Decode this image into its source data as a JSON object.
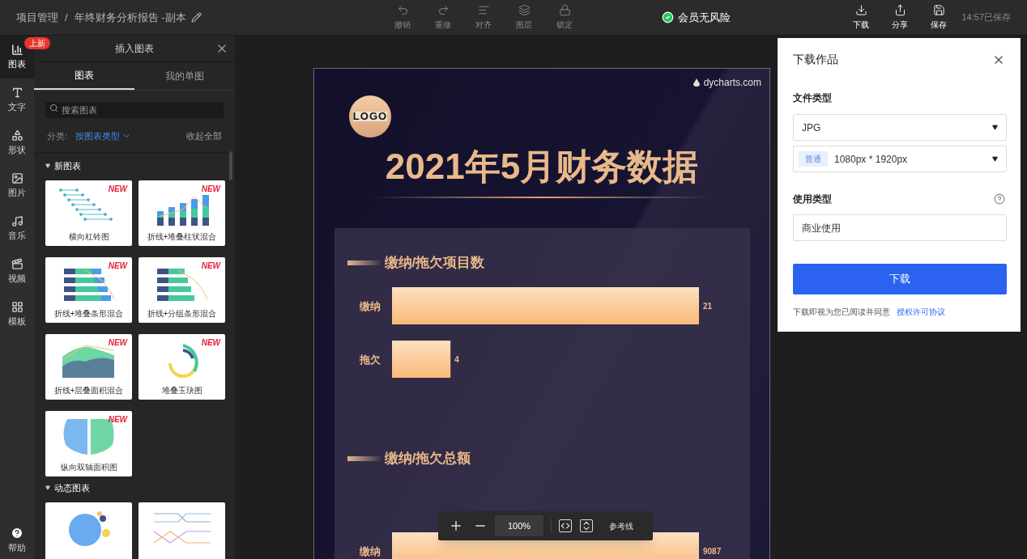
{
  "header": {
    "breadcrumb": [
      {
        "label": "项目管理"
      },
      {
        "label": "年终财务分析报告 -副本"
      }
    ],
    "separator": "/",
    "tools": [
      {
        "kind": "undo",
        "label": "撤销",
        "disabled": true
      },
      {
        "kind": "redo",
        "label": "重做",
        "disabled": true
      },
      {
        "kind": "align",
        "label": "对齐",
        "disabled": true
      },
      {
        "kind": "layers",
        "label": "图层",
        "disabled": true
      },
      {
        "kind": "lock",
        "label": "锁定",
        "disabled": true
      }
    ],
    "status": "会员无风险",
    "actions": [
      {
        "kind": "download",
        "label": "下载"
      },
      {
        "kind": "share",
        "label": "分享"
      },
      {
        "kind": "save",
        "label": "保存"
      }
    ],
    "saved": "14:57已保存"
  },
  "rail": {
    "badge": "上新",
    "items": [
      {
        "kind": "chart",
        "label": "图表",
        "selected": true
      },
      {
        "kind": "text",
        "label": "文字",
        "selected": false
      },
      {
        "kind": "shape",
        "label": "形状",
        "selected": false
      },
      {
        "kind": "image",
        "label": "图片",
        "selected": false
      },
      {
        "kind": "music",
        "label": "音乐",
        "selected": false
      },
      {
        "kind": "video",
        "label": "视频",
        "selected": false
      },
      {
        "kind": "template",
        "label": "模板",
        "selected": false
      }
    ],
    "help": "帮助"
  },
  "panel": {
    "title": "插入图表",
    "tabs": [
      {
        "label": "图表",
        "selected": true
      },
      {
        "label": "我的单图",
        "selected": false
      }
    ],
    "search": {
      "placeholder": "搜索图表"
    },
    "filter_label": "分类:",
    "filter_value": "按图表类型",
    "collapse": "收起全部",
    "sections": [
      {
        "title": "新图表",
        "expanded": true,
        "cards": [
          {
            "kind": "dumbbell",
            "label": "横向杠铃图",
            "badge": "NEW"
          },
          {
            "kind": "stacked-column-line",
            "label": "折线+堆叠柱状混合",
            "badge": "NEW"
          },
          {
            "kind": "stacked-bar-line",
            "label": "折线+堆叠条形混合",
            "badge": "NEW"
          },
          {
            "kind": "grouped-bar-line",
            "label": "折线+分组条形混合",
            "badge": "NEW"
          },
          {
            "kind": "stacked-area-line",
            "label": "折线+层叠面积混合",
            "badge": "NEW"
          },
          {
            "kind": "radial",
            "label": "堆叠玉玦图",
            "badge": "NEW"
          },
          {
            "kind": "mirror-area",
            "label": "纵向双轴面积图",
            "badge": "NEW"
          }
        ]
      },
      {
        "title": "动态图表",
        "expanded": true,
        "cards": [
          {
            "kind": "bubble"
          },
          {
            "kind": "bump"
          }
        ]
      }
    ]
  },
  "poster": {
    "brand": "dycharts.com",
    "logo": "LOGO",
    "title": "2021年5月财务数据",
    "charts": [
      {
        "heading": "缴纳/拖欠项目数",
        "chart_data": {
          "type": "bar",
          "orientation": "horizontal",
          "categories": [
            "缴纳",
            "拖欠"
          ],
          "values": [
            21,
            4
          ],
          "data_labels": true
        }
      },
      {
        "heading": "缴纳/拖欠总额",
        "chart_data": {
          "type": "bar",
          "orientation": "horizontal",
          "categories": [
            "缴纳"
          ],
          "values": [
            9087
          ],
          "data_labels": true
        }
      }
    ]
  },
  "zoom_bar": {
    "zoom": "100%",
    "guides": "参考线"
  },
  "download": {
    "title": "下载作品",
    "file_type_label": "文件类型",
    "file_type": "JPG",
    "size_badge": "普通",
    "size": "1080px * 1920px",
    "usage_label": "使用类型",
    "usage": "商业使用",
    "button": "下载",
    "notice": "下载即视为您已阅读并同意",
    "link": "授权许可协议"
  }
}
